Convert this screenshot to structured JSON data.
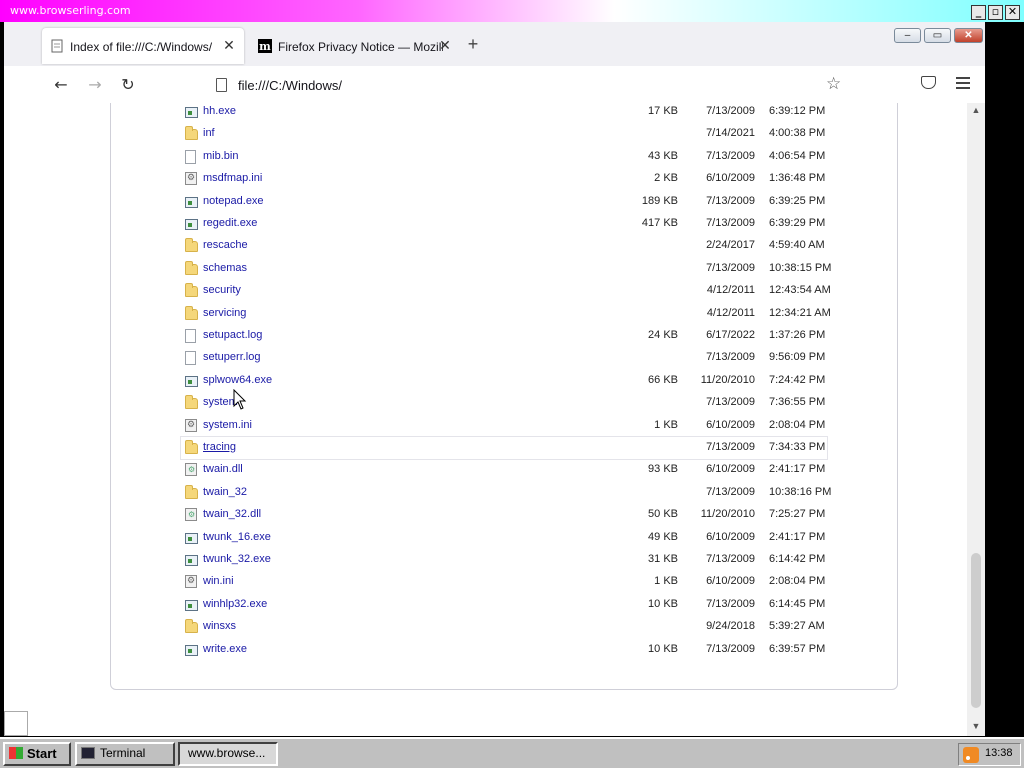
{
  "outer_window": {
    "title": "www.browserling.com",
    "controls": [
      "_",
      "▫",
      "✕"
    ]
  },
  "tabs": [
    {
      "label": "Index of file:///C:/Windows/",
      "active": true
    },
    {
      "label": "Firefox Privacy Notice — Mozilla",
      "active": false,
      "icon_letter": "m"
    }
  ],
  "window_controls": {
    "minimize": "–",
    "restore": "▭",
    "close": "✕"
  },
  "navbar": {
    "url": "file:///C:/Windows/"
  },
  "files": [
    {
      "name": "hh.exe",
      "type": "exe",
      "size": "17 KB",
      "date": "7/13/2009",
      "time": "6:39:12 PM"
    },
    {
      "name": "inf",
      "type": "folder",
      "size": "",
      "date": "7/14/2021",
      "time": "4:00:38 PM"
    },
    {
      "name": "mib.bin",
      "type": "file",
      "size": "43 KB",
      "date": "7/13/2009",
      "time": "4:06:54 PM"
    },
    {
      "name": "msdfmap.ini",
      "type": "ini",
      "size": "2 KB",
      "date": "6/10/2009",
      "time": "1:36:48 PM"
    },
    {
      "name": "notepad.exe",
      "type": "exe",
      "size": "189 KB",
      "date": "7/13/2009",
      "time": "6:39:25 PM"
    },
    {
      "name": "regedit.exe",
      "type": "exe",
      "size": "417 KB",
      "date": "7/13/2009",
      "time": "6:39:29 PM"
    },
    {
      "name": "rescache",
      "type": "folder",
      "size": "",
      "date": "2/24/2017",
      "time": "4:59:40 AM"
    },
    {
      "name": "schemas",
      "type": "folder",
      "size": "",
      "date": "7/13/2009",
      "time": "10:38:15 PM"
    },
    {
      "name": "security",
      "type": "folder",
      "size": "",
      "date": "4/12/2011",
      "time": "12:43:54 AM"
    },
    {
      "name": "servicing",
      "type": "folder",
      "size": "",
      "date": "4/12/2011",
      "time": "12:34:21 AM"
    },
    {
      "name": "setupact.log",
      "type": "file",
      "size": "24 KB",
      "date": "6/17/2022",
      "time": "1:37:26 PM"
    },
    {
      "name": "setuperr.log",
      "type": "file",
      "size": "",
      "date": "7/13/2009",
      "time": "9:56:09 PM"
    },
    {
      "name": "splwow64.exe",
      "type": "exe",
      "size": "66 KB",
      "date": "11/20/2010",
      "time": "7:24:42 PM"
    },
    {
      "name": "system",
      "type": "folder",
      "size": "",
      "date": "7/13/2009",
      "time": "7:36:55 PM"
    },
    {
      "name": "system.ini",
      "type": "ini",
      "size": "1 KB",
      "date": "6/10/2009",
      "time": "2:08:04 PM"
    },
    {
      "name": "tracing",
      "type": "folder",
      "size": "",
      "date": "7/13/2009",
      "time": "7:34:33 PM",
      "hover": true
    },
    {
      "name": "twain.dll",
      "type": "dll",
      "size": "93 KB",
      "date": "6/10/2009",
      "time": "2:41:17 PM"
    },
    {
      "name": "twain_32",
      "type": "folder",
      "size": "",
      "date": "7/13/2009",
      "time": "10:38:16 PM"
    },
    {
      "name": "twain_32.dll",
      "type": "dll",
      "size": "50 KB",
      "date": "11/20/2010",
      "time": "7:25:27 PM"
    },
    {
      "name": "twunk_16.exe",
      "type": "exe",
      "size": "49 KB",
      "date": "6/10/2009",
      "time": "2:41:17 PM"
    },
    {
      "name": "twunk_32.exe",
      "type": "exe",
      "size": "31 KB",
      "date": "7/13/2009",
      "time": "6:14:42 PM"
    },
    {
      "name": "win.ini",
      "type": "ini",
      "size": "1 KB",
      "date": "6/10/2009",
      "time": "2:08:04 PM"
    },
    {
      "name": "winhlp32.exe",
      "type": "exe",
      "size": "10 KB",
      "date": "7/13/2009",
      "time": "6:14:45 PM"
    },
    {
      "name": "winsxs",
      "type": "folder",
      "size": "",
      "date": "9/24/2018",
      "time": "5:39:27 AM"
    },
    {
      "name": "write.exe",
      "type": "exe",
      "size": "10 KB",
      "date": "7/13/2009",
      "time": "6:39:57 PM"
    }
  ],
  "taskbar": {
    "start_label": "Start",
    "tasks": [
      {
        "label": "Terminal",
        "pressed": false
      },
      {
        "label": "www.browse...",
        "pressed": true
      }
    ],
    "clock": "13:38"
  },
  "colors": {
    "link": "#1a1aa6",
    "folder": "#f5d77a",
    "taskbar": "#c0c0c0"
  }
}
